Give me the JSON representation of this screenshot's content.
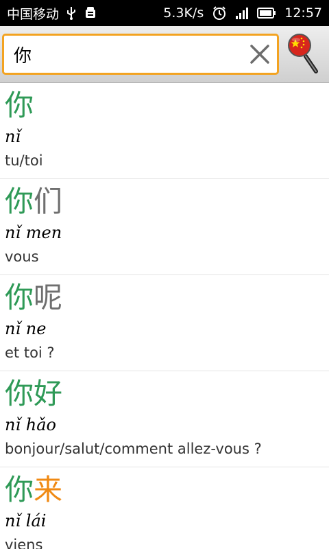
{
  "status_bar": {
    "carrier": "中国移动",
    "speed": "5.3K/s",
    "time": "12:57"
  },
  "search": {
    "query": "你"
  },
  "colors": {
    "green": "#2f9a57",
    "gray": "#6f6f6f",
    "orange": "#f08a14",
    "accent_border": "#f3a321"
  },
  "entries": [
    {
      "chars": [
        {
          "c": "你",
          "tone": "green"
        }
      ],
      "pinyin": "nǐ",
      "meaning": "tu/toi"
    },
    {
      "chars": [
        {
          "c": "你",
          "tone": "green"
        },
        {
          "c": "们",
          "tone": "gray"
        }
      ],
      "pinyin": "nǐ men",
      "meaning": "vous"
    },
    {
      "chars": [
        {
          "c": "你",
          "tone": "green"
        },
        {
          "c": "呢",
          "tone": "gray"
        }
      ],
      "pinyin": "nǐ ne",
      "meaning": "et toi ?"
    },
    {
      "chars": [
        {
          "c": "你",
          "tone": "green"
        },
        {
          "c": "好",
          "tone": "green"
        }
      ],
      "pinyin": "nǐ hǎo",
      "meaning": "bonjour/salut/comment allez-vous ?"
    },
    {
      "chars": [
        {
          "c": "你",
          "tone": "green"
        },
        {
          "c": "来",
          "tone": "orange"
        }
      ],
      "pinyin": "nǐ lái",
      "meaning": "viens"
    }
  ]
}
